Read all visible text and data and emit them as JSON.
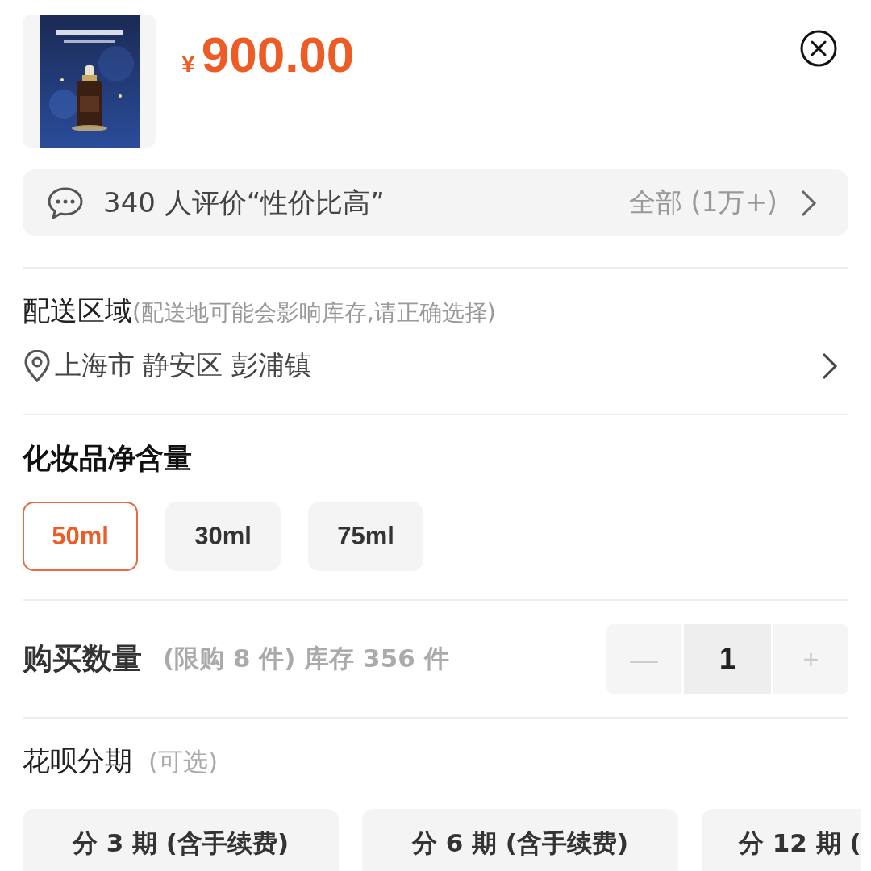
{
  "product": {
    "currency": "¥",
    "price": "900.00"
  },
  "review_bar": {
    "summary": "340 人评价“性价比高”",
    "all_link": "全部 (1万+)"
  },
  "delivery": {
    "title": "配送区域",
    "hint": "(配送地可能会影响库存,请正确选择)",
    "location": "上海市 静安区 彭浦镇"
  },
  "spec": {
    "title": "化妆品净含量",
    "options": [
      {
        "label": "50ml",
        "selected": true
      },
      {
        "label": "30ml",
        "selected": false
      },
      {
        "label": "75ml",
        "selected": false
      }
    ]
  },
  "quantity": {
    "title": "购买数量",
    "info": "(限购 8 件) 库存 356 件",
    "minus": "—",
    "value": "1",
    "plus": "+"
  },
  "installment": {
    "title": "花呗分期",
    "hint": "(可选)",
    "plans": [
      {
        "label": "分 3 期 (含手续费)"
      },
      {
        "label": "分 6 期 (含手续费)"
      },
      {
        "label": "分 12 期 ("
      }
    ]
  }
}
